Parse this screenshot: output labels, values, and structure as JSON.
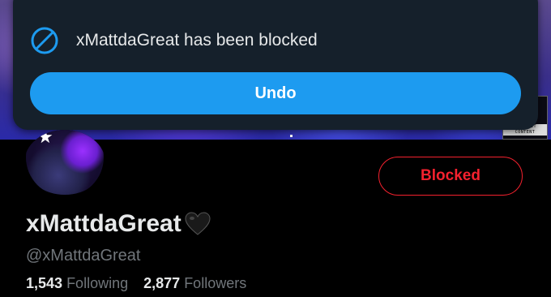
{
  "toast": {
    "message": "xMattdaGreat has been blocked",
    "undo_label": "Undo",
    "icon": "block-icon"
  },
  "banner": {
    "advisory_big": "RT",
    "advisory_small": "EXPLICIT CONTENT"
  },
  "profile": {
    "display_name": "xMattdaGreat",
    "name_emoji_icon": "black-heart-icon",
    "handle": "@xMattdaGreat",
    "blocked_label": "Blocked",
    "following_count": "1,543",
    "following_label": "Following",
    "followers_count": "2,877",
    "followers_label": "Followers"
  },
  "colors": {
    "accent": "#1d9bf0",
    "danger": "#f4212e",
    "toast_bg": "#15202b",
    "muted": "#71767b"
  }
}
